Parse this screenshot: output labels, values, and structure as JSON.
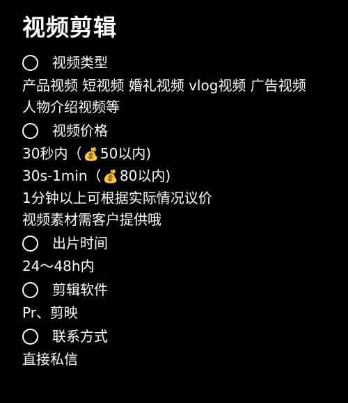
{
  "title": "视频剪辑",
  "sections": [
    {
      "heading": "视频类型",
      "lines": [
        "产品视频 短视频 婚礼视频 vlog视频 广告视频 人物介绍视频等"
      ]
    },
    {
      "heading": "视频价格",
      "price_lines": [
        {
          "prefix": "30秒内（",
          "icon": "money-bag-icon",
          "emoji": "💰",
          "suffix": "50以内)"
        },
        {
          "prefix": "30s-1min（",
          "icon": "money-bag-icon",
          "emoji": "💰",
          "suffix": "80以内)"
        }
      ],
      "lines": [
        "1分钟以上可根据实际情况议价",
        "视频素材需客户提供哦"
      ]
    },
    {
      "heading": "出片时间",
      "lines": [
        "24～48h内"
      ]
    },
    {
      "heading": "剪辑软件",
      "lines": [
        "Pr、剪映"
      ]
    },
    {
      "heading": "联系方式",
      "lines": [
        "直接私信"
      ]
    }
  ]
}
